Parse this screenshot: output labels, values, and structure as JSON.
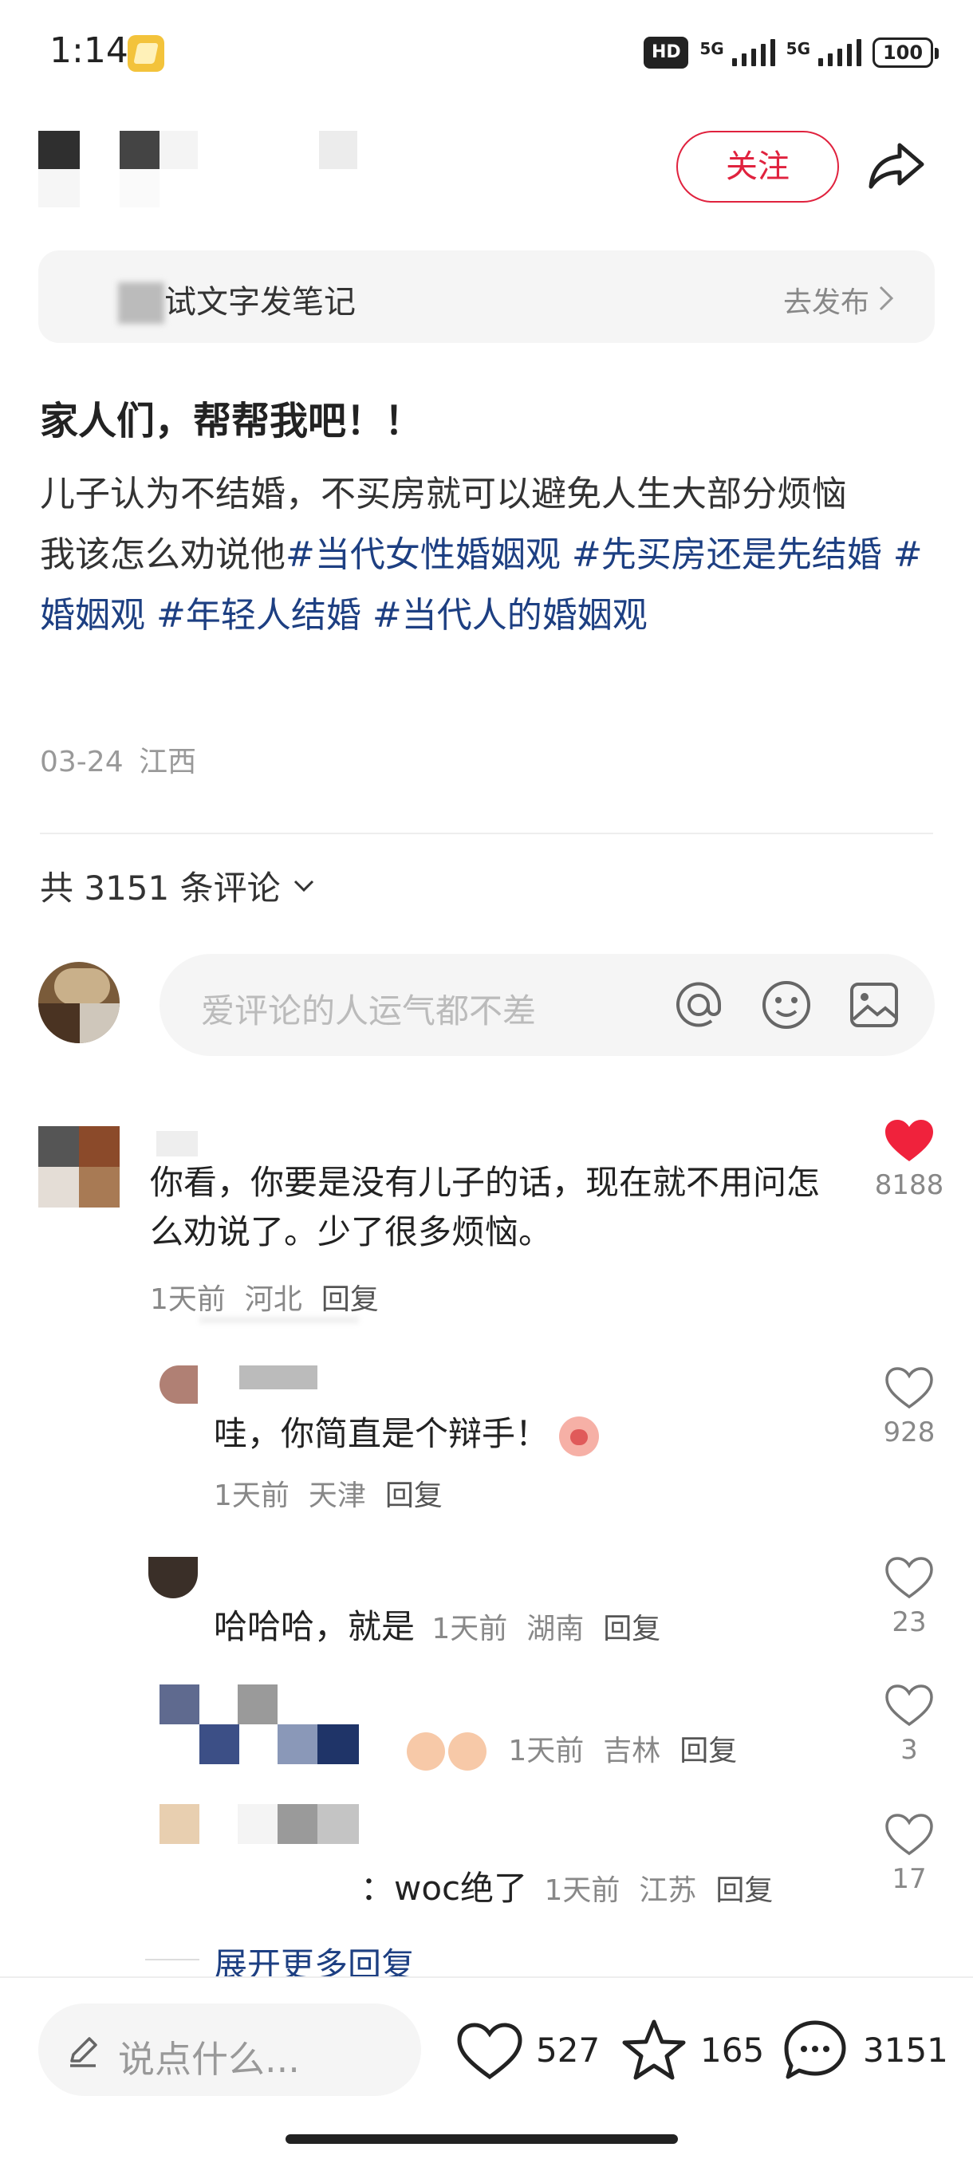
{
  "status_bar": {
    "time": "1:14",
    "hd_label": "HD",
    "signal_1_label": "5G",
    "signal_2_label": "5G",
    "battery": "100"
  },
  "header": {
    "follow_label": "关注",
    "share_icon": "share-arrow-icon"
  },
  "banner": {
    "text": "试文字发笔记",
    "action": "去发布"
  },
  "post": {
    "title": "家人们，帮帮我吧！！",
    "line1": "儿子认为不结婚，不买房就可以避免人生大部分烦恼",
    "line2": "我该怎么劝说他",
    "tags": [
      "#当代女性婚姻观",
      "#先买房还是先结婚",
      "#婚姻观",
      "#年轻人结婚",
      "#当代人的婚姻观"
    ],
    "date": "03-24",
    "location": "江西"
  },
  "comments_header": {
    "count_label": "共 3151 条评论"
  },
  "comment_input": {
    "placeholder": "爱评论的人运气都不差"
  },
  "top_comment": {
    "text": "你看，你要是没有儿子的话，现在就不用问怎么劝说了。少了很多烦恼。",
    "time": "1天前",
    "location": "河北",
    "reply_label": "回复",
    "likes": "8188"
  },
  "replies": [
    {
      "text": "哇，你简直是个辩手！",
      "time": "1天前",
      "location": "天津",
      "reply_label": "回复",
      "likes": "928"
    },
    {
      "text": "哈哈哈，就是",
      "time": "1天前",
      "location": "湖南",
      "reply_label": "回复",
      "likes": "23"
    },
    {
      "text": "",
      "time": "1天前",
      "location": "吉林",
      "reply_label": "回复",
      "likes": "3"
    },
    {
      "text": "：woc绝了",
      "time": "1天前",
      "location": "江苏",
      "reply_label": "回复",
      "likes": "17"
    }
  ],
  "expand_label": "展开更多回复",
  "bottom_bar": {
    "say_placeholder": "说点什么...",
    "likes": "527",
    "stars": "165",
    "comments": "3151"
  },
  "colors": {
    "accent_red": "#e0223e",
    "tag_blue": "#1d3f82",
    "heart_red": "#f0223c"
  }
}
